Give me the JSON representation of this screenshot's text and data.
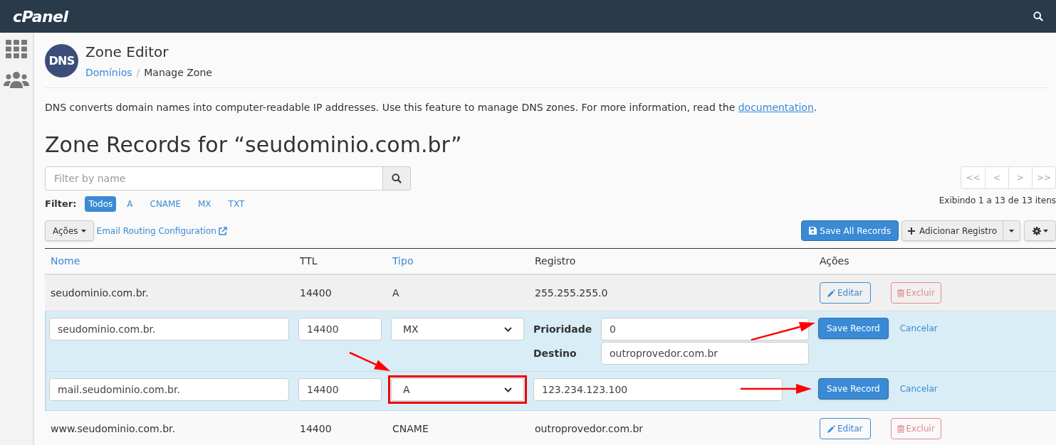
{
  "header": {
    "logo": "cPanel"
  },
  "page": {
    "title": "Zone Editor",
    "icon_text": "DNS",
    "breadcrumb": [
      {
        "label": "Domínios",
        "link": true
      },
      {
        "label": "Manage Zone",
        "link": false
      }
    ],
    "breadcrumb_separator": "/"
  },
  "description": {
    "text": "DNS converts domain names into computer-readable IP addresses. Use this feature to manage DNS zones. For more information, read the ",
    "link": "documentation",
    "end": "."
  },
  "zone_title": "Zone Records for “seudominio.com.br”",
  "search": {
    "placeholder": "Filter by name"
  },
  "filter": {
    "label": "Filter:",
    "options": [
      {
        "label": "Todos",
        "selected": true
      },
      {
        "label": "A",
        "selected": false
      },
      {
        "label": "CNAME",
        "selected": false
      },
      {
        "label": "MX",
        "selected": false
      },
      {
        "label": "TXT",
        "selected": false
      }
    ]
  },
  "pagination": {
    "buttons": [
      "<<",
      "<",
      ">",
      ">>"
    ],
    "summary": "Exibindo 1 a 13 de 13 itens"
  },
  "toolbar": {
    "actions": "Ações",
    "email_routing": "Email Routing Configuration",
    "save_all": "Save All Records",
    "add_record": "Adicionar Registro"
  },
  "table": {
    "columns": [
      {
        "label": "Nome",
        "sortable": true
      },
      {
        "label": "TTL",
        "sortable": false
      },
      {
        "label": "Tipo",
        "sortable": true
      },
      {
        "label": "Registro",
        "sortable": false
      },
      {
        "label": "Ações",
        "sortable": false
      }
    ],
    "rows": [
      {
        "kind": "view",
        "name": "seudominio.com.br.",
        "ttl": "14400",
        "type": "A",
        "record": "255.255.255.0",
        "edit": "Editar",
        "delete": "Excluir"
      },
      {
        "kind": "edit",
        "name": "seudominio.com.br.",
        "ttl": "14400",
        "type": "MX",
        "highlighted": false,
        "arrow_to_type": false,
        "fields": [
          {
            "label": "Prioridade",
            "value": "0"
          },
          {
            "label": "Destino",
            "value": "outroprovedor.com.br"
          }
        ],
        "save": "Save Record",
        "cancel": "Cancelar",
        "arrow_to_save": true
      },
      {
        "kind": "edit",
        "name": "mail.seudominio.com.br.",
        "ttl": "14400",
        "type": "A",
        "highlighted": true,
        "arrow_to_type": true,
        "fields": [
          {
            "value": "123.234.123.100"
          }
        ],
        "save": "Save Record",
        "cancel": "Cancelar",
        "arrow_to_save": true
      },
      {
        "kind": "view",
        "name": "www.seudominio.com.br.",
        "ttl": "14400",
        "type": "CNAME",
        "record": "outroprovedor.com.br",
        "edit": "Editar",
        "delete": "Excluir"
      }
    ]
  }
}
